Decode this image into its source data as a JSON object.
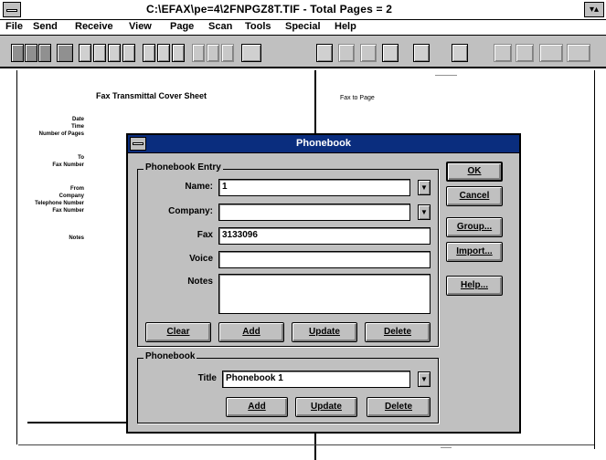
{
  "window": {
    "title": "C:\\EFAX\\pe=4\\2FNPGZ8T.TIF - Total Pages = 2"
  },
  "menu": [
    "File",
    "Send",
    "Receive",
    "View",
    "Page",
    "Scan",
    "Tools",
    "Special",
    "Help"
  ],
  "document": {
    "heading": "Fax Transmittal Cover Sheet",
    "right_text": "Fax to Page",
    "left_labels": [
      "Date",
      "Time",
      "Number of Pages",
      "To",
      "Fax Number",
      "From",
      "Company",
      "Telephone Number",
      "Fax Number",
      "Notes"
    ]
  },
  "phonebook": {
    "title": "Phonebook",
    "entry_group_label": "Phonebook Entry",
    "name_label": "Name:",
    "name_value": "1",
    "company_label": "Company:",
    "company_value": "",
    "fax_label": "Fax",
    "fax_value": "3133096",
    "voice_label": "Voice",
    "voice_value": "",
    "notes_label": "Notes",
    "notes_value": "",
    "entry_buttons": {
      "clear": "Clear",
      "add": "Add",
      "update": "Update",
      "delete": "Delete"
    },
    "file_group_label": "Phonebook",
    "file_label": "Title",
    "file_value": "Phonebook 1",
    "file_buttons": {
      "add": "Add",
      "update": "Update",
      "delete": "Delete"
    },
    "side_buttons": {
      "ok": "OK",
      "cancel": "Cancel",
      "group": "Group...",
      "import": "Import...",
      "help": "Help..."
    }
  }
}
